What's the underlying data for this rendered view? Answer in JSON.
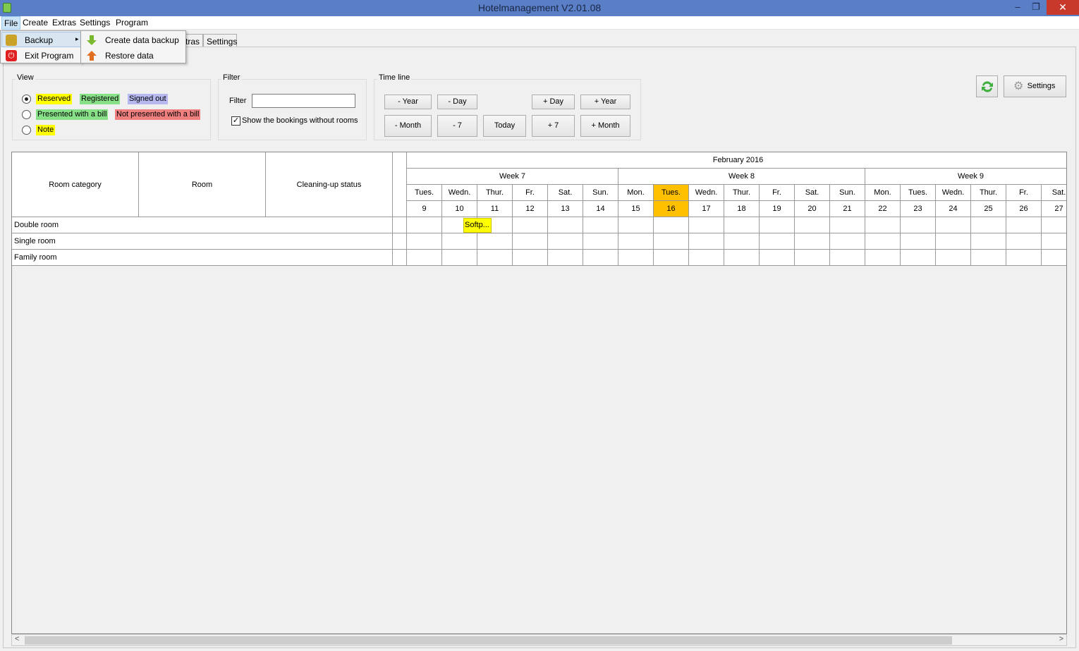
{
  "window": {
    "title": "Hotelmanagement V2.01.08"
  },
  "menubar": [
    "File",
    "Create",
    "Extras",
    "Settings",
    "Program"
  ],
  "file_menu": {
    "items": [
      "Backup",
      "Exit Program"
    ]
  },
  "backup_submenu": {
    "items": [
      "Create data backup",
      "Restore data"
    ]
  },
  "tabs": [
    "tras",
    "Settings"
  ],
  "view_group": {
    "label": "View",
    "options": [
      {
        "chips": [
          "Reserved",
          "Registered",
          "Signed out"
        ],
        "selected": true
      },
      {
        "chips": [
          "Presented with a bill",
          "Not presented with a bill"
        ],
        "selected": false
      },
      {
        "chips": [
          "Note"
        ],
        "selected": false
      }
    ]
  },
  "filter_group": {
    "label": "Filter",
    "field_label": "Filter",
    "field_value": "",
    "checkbox_label": "Show the bookings without rooms",
    "checked": true
  },
  "timeline_group": {
    "label": "Time line",
    "row1": [
      "- Year",
      "- Day",
      "+ Day",
      "+ Year"
    ],
    "row2": [
      "- Month",
      "- 7",
      "Today",
      "+ 7",
      "+ Month"
    ]
  },
  "toolbar": {
    "settings_label": "Settings"
  },
  "grid": {
    "columns": [
      "Room category",
      "Room",
      "Cleaning-up status"
    ],
    "month": "February 2016",
    "weeks": [
      "Week 7",
      "Week 8",
      "Week 9"
    ],
    "days": [
      {
        "name": "Tues.",
        "num": "9"
      },
      {
        "name": "Wedn.",
        "num": "10"
      },
      {
        "name": "Thur.",
        "num": "11"
      },
      {
        "name": "Fr.",
        "num": "12"
      },
      {
        "name": "Sat.",
        "num": "13"
      },
      {
        "name": "Sun.",
        "num": "14"
      },
      {
        "name": "Mon.",
        "num": "15"
      },
      {
        "name": "Tues.",
        "num": "16"
      },
      {
        "name": "Wedn.",
        "num": "17"
      },
      {
        "name": "Thur.",
        "num": "18"
      },
      {
        "name": "Fr.",
        "num": "19"
      },
      {
        "name": "Sat.",
        "num": "20"
      },
      {
        "name": "Sun.",
        "num": "21"
      },
      {
        "name": "Mon.",
        "num": "22"
      },
      {
        "name": "Tues.",
        "num": "23"
      },
      {
        "name": "Wedn.",
        "num": "24"
      },
      {
        "name": "Thur.",
        "num": "25"
      },
      {
        "name": "Fr.",
        "num": "26"
      },
      {
        "name": "Sat.",
        "num": "27"
      }
    ],
    "today_index": 7,
    "rows": [
      "Double room",
      "Single room",
      "Family room"
    ],
    "booking": {
      "label": "Softp...",
      "row": 0,
      "start_day": 1,
      "length_days": 0.8
    }
  },
  "colors": {
    "reserved": "#ffff00",
    "registered": "#88e088",
    "signed_out": "#b8b8f0",
    "bill": "#88e088",
    "no_bill": "#f08080",
    "note": "#ffff00",
    "today": "#ffc000"
  }
}
